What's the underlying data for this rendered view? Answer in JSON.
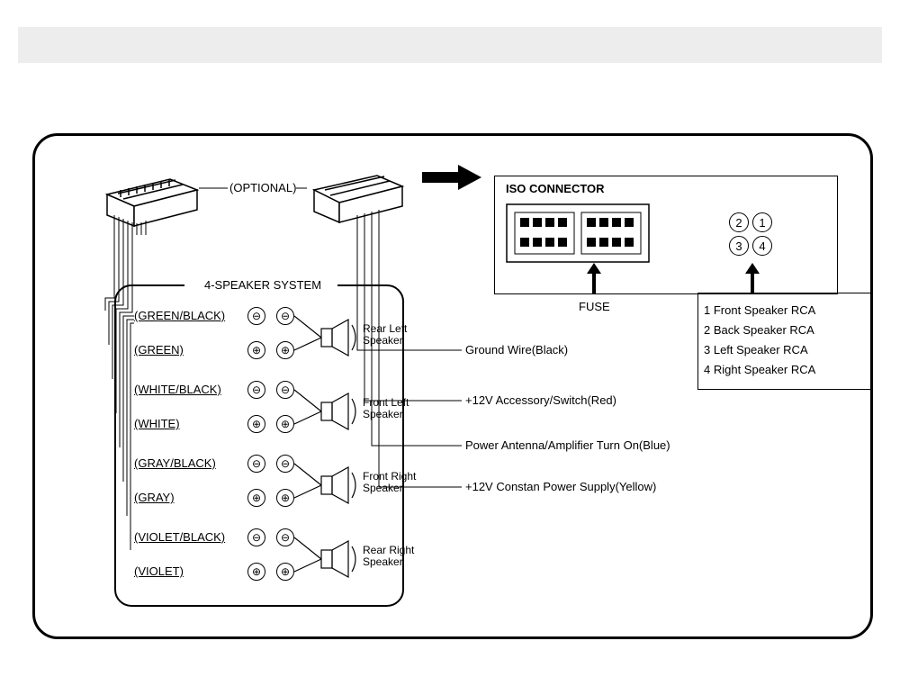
{
  "header": {
    "optional_label": "(OPTIONAL)",
    "iso_title": "ISO CONNECTOR",
    "fuse_label": "FUSE"
  },
  "speaker_system": {
    "title": "4-SPEAKER SYSTEM",
    "wires": [
      {
        "color": "(GREEN/BLACK)",
        "polarity": "-"
      },
      {
        "color": "(GREEN)",
        "polarity": "+"
      },
      {
        "color": "(WHITE/BLACK)",
        "polarity": "-"
      },
      {
        "color": "(WHITE)",
        "polarity": "+"
      },
      {
        "color": "(GRAY/BLACK)",
        "polarity": "-"
      },
      {
        "color": "(GRAY)",
        "polarity": "+"
      },
      {
        "color": "(VIOLET/BLACK)",
        "polarity": "-"
      },
      {
        "color": "(VIOLET)",
        "polarity": "+"
      }
    ],
    "speakers": [
      {
        "name": "Rear Left\nSpeaker"
      },
      {
        "name": "Front Left\nSpeaker"
      },
      {
        "name": "Front Right\nSpeaker"
      },
      {
        "name": "Rear Right\nSpeaker"
      }
    ]
  },
  "power_wires": [
    "Ground Wire(Black)",
    "+12V Accessory/Switch(Red)",
    "Power Antenna/Amplifier Turn On(Blue)",
    "+12V Constan Power Supply(Yellow)"
  ],
  "rca": {
    "numbers": [
      "2",
      "1",
      "3",
      "4"
    ],
    "legend": [
      "1 Front Speaker RCA",
      "2 Back Speaker RCA",
      "3 Left  Speaker RCA",
      "4 Right  Speaker RCA"
    ]
  },
  "glyphs": {
    "minus": "⊖",
    "plus": "⊕"
  }
}
